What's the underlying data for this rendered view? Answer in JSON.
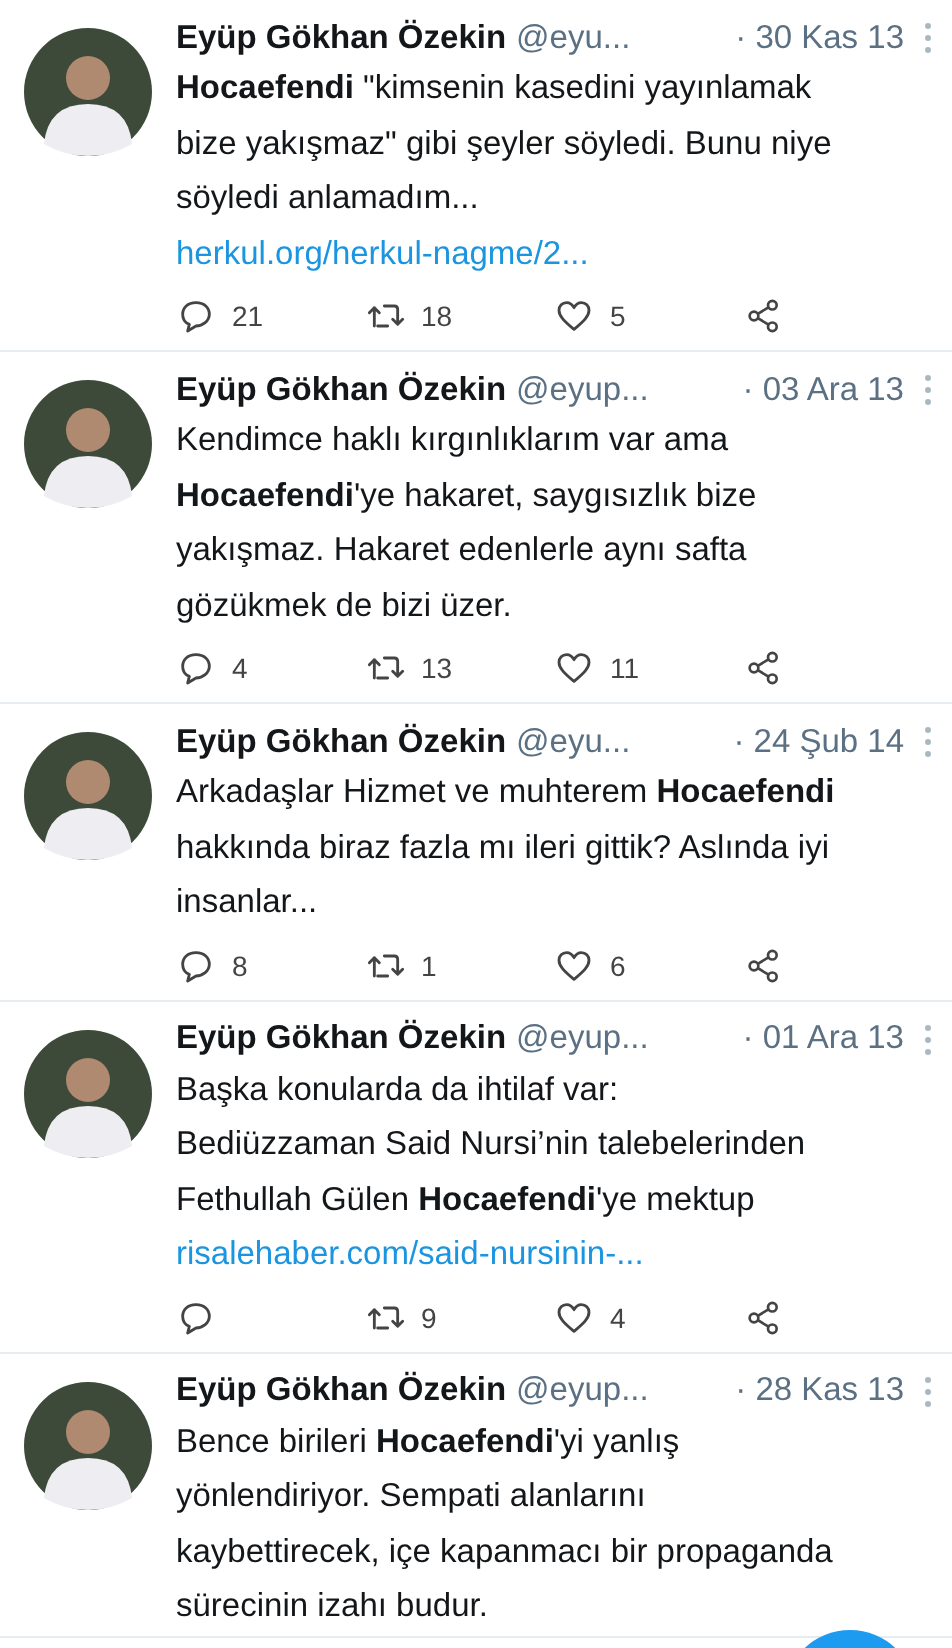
{
  "tweets": [
    {
      "name": "Eyüp Gökhan Özekin",
      "handle": "@eyu...",
      "date": "· 30 Kas 13",
      "lines": [
        "**Hocaefendi** \"kimsenin kasedini yayınlamak",
        "bize yakışmaz\" gibi şeyler söyledi. Bunu niye",
        "söyledi anlamadım..."
      ],
      "link": "herkul.org/herkul-nagme/2...",
      "replies": "21",
      "retweets": "18",
      "likes": "5"
    },
    {
      "name": "Eyüp Gökhan Özekin",
      "handle": "@eyup...",
      "date": "· 03 Ara 13",
      "lines": [
        "Kendimce haklı kırgınlıklarım var ama",
        "**Hocaefendi**'ye hakaret, saygısızlık bize",
        "yakışmaz. Hakaret edenlerle aynı safta",
        "gözükmek de bizi üzer."
      ],
      "replies": "4",
      "retweets": "13",
      "likes": "11"
    },
    {
      "name": "Eyüp Gökhan Özekin",
      "handle": "@eyu...",
      "date": "· 24 Şub 14",
      "lines": [
        "Arkadaşlar Hizmet ve muhterem **Hocaefendi**",
        "hakkında biraz fazla mı ileri gittik? Aslında iyi",
        "insanlar..."
      ],
      "replies": "8",
      "retweets": "1",
      "likes": "6"
    },
    {
      "name": "Eyüp Gökhan Özekin",
      "handle": "@eyup...",
      "date": "· 01 Ara 13",
      "lines": [
        "Başka konularda da ihtilaf var:",
        "Bediüzzaman Said Nursi’nin talebelerinden",
        "Fethullah Gülen **Hocaefendi**'ye mektup"
      ],
      "link": "risalehaber.com/said-nursinin-...",
      "retweets": "9",
      "likes": "4"
    },
    {
      "name": "Eyüp Gökhan Özekin",
      "handle": "@eyup...",
      "date": "· 28 Kas 13",
      "lines": [
        "Bence birileri **Hocaefendi**'yi yanlış",
        "yönlendiriyor. Sempati alanlarını",
        "kaybettirecek, içe kapanmacı bir propaganda",
        "sürecinin izahı budur."
      ]
    }
  ]
}
